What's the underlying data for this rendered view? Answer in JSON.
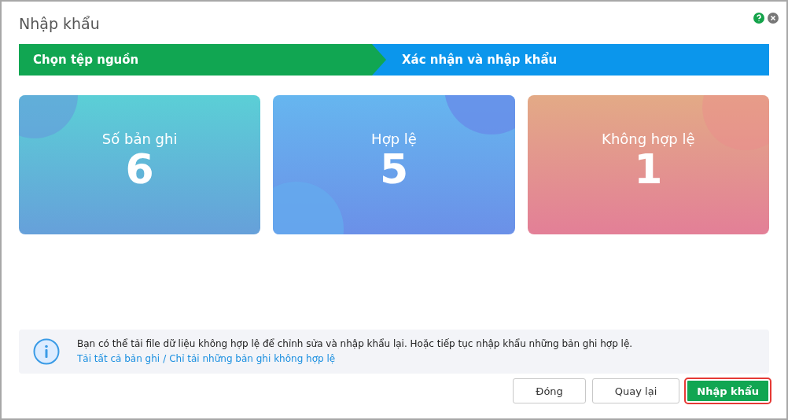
{
  "window": {
    "title": "Nhập khẩu"
  },
  "steps": [
    {
      "label": "Chọn tệp nguồn",
      "selected": false
    },
    {
      "label": "Xác nhận và nhập khẩu",
      "selected": true
    }
  ],
  "cards": [
    {
      "kind": "total",
      "label": "Số bản ghi",
      "value": "6"
    },
    {
      "kind": "valid",
      "label": "Hợp lệ",
      "value": "5"
    },
    {
      "kind": "invalid",
      "label": "Không hợp lệ",
      "value": "1"
    }
  ],
  "info": {
    "message": "Bạn có thể tải file dữ liệu không hợp lệ để chỉnh sửa và nhập khẩu lại. Hoặc tiếp tục nhập khẩu những bản ghi hợp lệ.",
    "links": [
      "Tải tất cả bản ghi",
      "Chỉ tải những bản ghi không hợp lệ"
    ],
    "separator": "/"
  },
  "buttons": [
    {
      "label": "Đóng",
      "kind": "default"
    },
    {
      "label": "Quay lại",
      "kind": "default"
    },
    {
      "label": "Nhập khẩu",
      "kind": "primary"
    }
  ]
}
